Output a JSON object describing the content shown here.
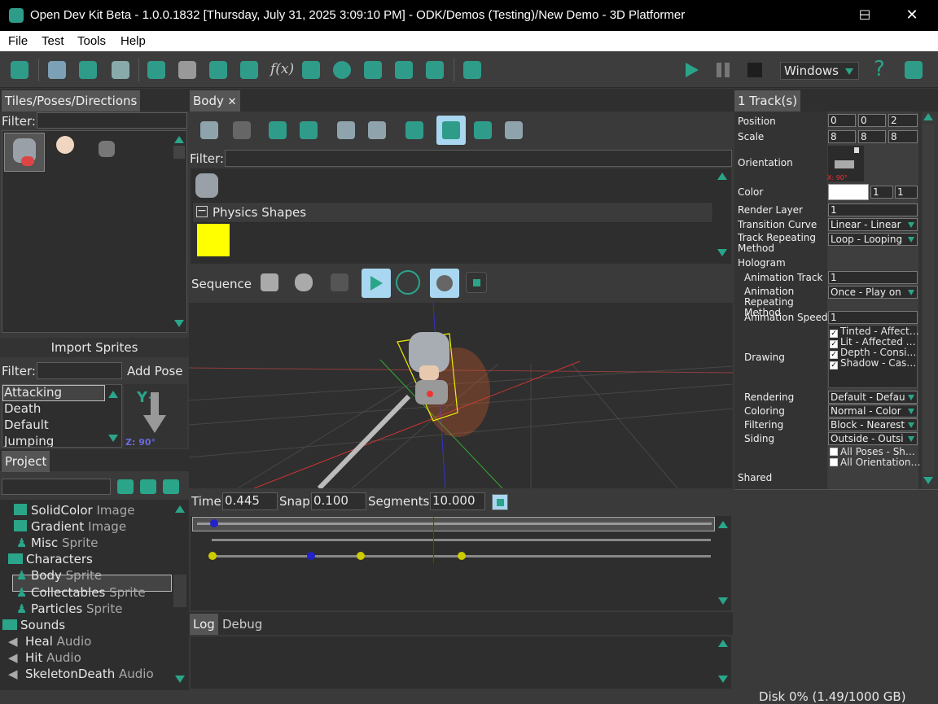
{
  "window": {
    "title": "Open Dev Kit Beta - 1.0.0.1832 [Thursday, July 31, 2025 3:09:10 PM] - ODK/Demos (Testing)/New Demo - 3D Platformer",
    "minimize": "─",
    "maximize": "☐",
    "close": "✕"
  },
  "menu": [
    "File",
    "Test",
    "Tools",
    "Help"
  ],
  "toolbar": {
    "platform": "Windows",
    "help": "?"
  },
  "left": {
    "tab": "Tiles/Poses/Directions",
    "filter_label": "Filter:",
    "import_sprites": "Import Sprites",
    "filter2_label": "Filter:",
    "add_pose": "Add Pose",
    "poses": [
      "Attacking",
      "Death",
      "Default",
      "Jumping"
    ],
    "axis_y": "Y+",
    "axis_z": "Z: 90°"
  },
  "project": {
    "tab": "Project",
    "items": [
      {
        "name": "SolidColor",
        "type": "Image"
      },
      {
        "name": "Gradient",
        "type": "Image"
      },
      {
        "name": "Misc",
        "type": "Sprite"
      },
      {
        "name": "Characters",
        "type": ""
      },
      {
        "name": "Body",
        "type": "Sprite"
      },
      {
        "name": "Collectables",
        "type": "Sprite"
      },
      {
        "name": "Particles",
        "type": "Sprite"
      },
      {
        "name": "Sounds",
        "type": ""
      },
      {
        "name": "Heal",
        "type": "Audio"
      },
      {
        "name": "Hit",
        "type": "Audio"
      },
      {
        "name": "SkeletonDeath",
        "type": "Audio"
      }
    ]
  },
  "center": {
    "tab": "Body",
    "tab_close": "✕",
    "filter_label": "Filter:",
    "physics_shapes": "Physics Shapes",
    "collapse": "−",
    "sequence_label": "Sequence",
    "time_label": "Time",
    "time_value": "0.445",
    "snap_label": "Snap",
    "snap_value": "0.100",
    "segments_label": "Segments",
    "segments_value": "10.000"
  },
  "log": {
    "tabs": [
      "Log",
      "Debug"
    ]
  },
  "right": {
    "tab": "1 Track(s)",
    "position_label": "Position",
    "position": [
      "0",
      "0",
      "2"
    ],
    "scale_label": "Scale",
    "scale": [
      "8",
      "8",
      "8"
    ],
    "orientation_label": "Orientation",
    "orientation_hint": "X: 90°",
    "color_label": "Color",
    "color_vals": [
      "1",
      "1"
    ],
    "color_swatch": "#ffffff",
    "render_layer_label": "Render Layer",
    "render_layer": "1",
    "transition_curve_label": "Transition Curve",
    "transition_curve": "Linear - Linear",
    "track_repeating_label": "Track Repeating Method",
    "track_repeating": "Loop - Looping",
    "hologram_label": "Hologram",
    "animation_track_label": "Animation Track",
    "animation_track": "1",
    "anim_repeating_label": "Animation Repeating Method",
    "anim_repeating": "Once - Play on",
    "anim_speed_label": "Animation Speed",
    "anim_speed": "1",
    "drawing_label": "Drawing",
    "drawing_checks": [
      "Tinted - Affect…",
      "Lit - Affected …",
      "Depth - Consi…",
      "Shadow - Cas…"
    ],
    "rendering_label": "Rendering",
    "rendering": "Default - Defau",
    "coloring_label": "Coloring",
    "coloring": "Normal - Color",
    "filtering_label": "Filtering",
    "filtering": "Block - Nearest",
    "siding_label": "Siding",
    "siding": "Outside - Outsi",
    "all_poses": "All Poses - Sh…",
    "all_orientations": "All Orientation…",
    "shared_label": "Shared"
  },
  "status": {
    "disk": "Disk 0% (1.49/1000 GB)"
  },
  "colors": {
    "accent": "#2aa58a",
    "physics_shape": "#ffff00",
    "selected_tool": "#a9d6f0"
  }
}
